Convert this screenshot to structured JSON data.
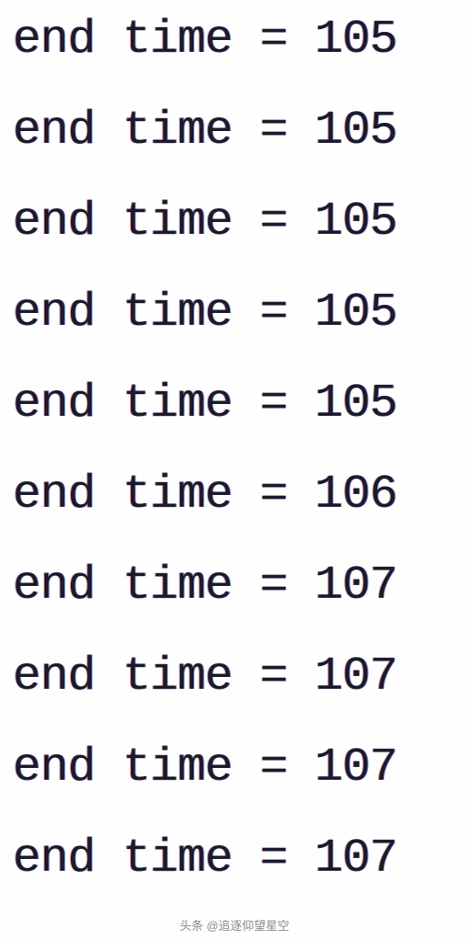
{
  "lines": [
    "end time = 105",
    "end time = 105",
    "end time = 105",
    "end time = 105",
    "end time = 105",
    "end time = 106",
    "end time = 107",
    "end time = 107",
    "end time = 107",
    "end time = 107"
  ],
  "footer": "头条 @追逐仰望星空"
}
